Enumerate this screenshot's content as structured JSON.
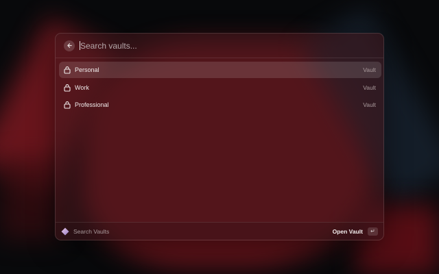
{
  "search": {
    "placeholder": "Search vaults..."
  },
  "vaults": [
    {
      "label": "Personal",
      "type": "Vault",
      "icon": "lock-icon",
      "selected": true
    },
    {
      "label": "Work",
      "type": "Vault",
      "icon": "lock-icon",
      "selected": false
    },
    {
      "label": "Professional",
      "type": "Vault",
      "icon": "lock-icon",
      "selected": false
    }
  ],
  "footer": {
    "title": "Search Vaults",
    "primary_action": "Open Vault",
    "shortcut": "↵"
  },
  "colors": {
    "accent": "#6a141b",
    "background": "#08090b"
  }
}
